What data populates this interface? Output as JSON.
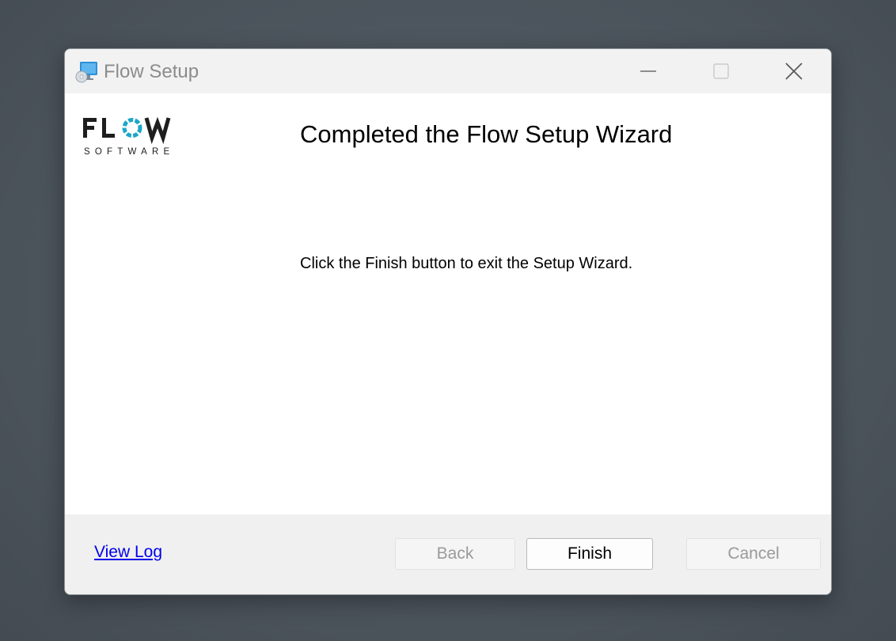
{
  "window": {
    "title": "Flow Setup",
    "controls": {
      "minimize": "minimize-icon",
      "maximize": "maximize-icon",
      "close": "close-icon"
    }
  },
  "logo": {
    "brand": "FLOW",
    "subtitle": "SOFTWARE",
    "accent_color": "#1aa6c9",
    "text_color": "#1e1e1e"
  },
  "main": {
    "heading": "Completed the Flow Setup Wizard",
    "message": "Click the Finish button to exit the Setup Wizard."
  },
  "footer": {
    "view_log_label": "View Log",
    "back_label": "Back",
    "finish_label": "Finish",
    "cancel_label": "Cancel"
  }
}
